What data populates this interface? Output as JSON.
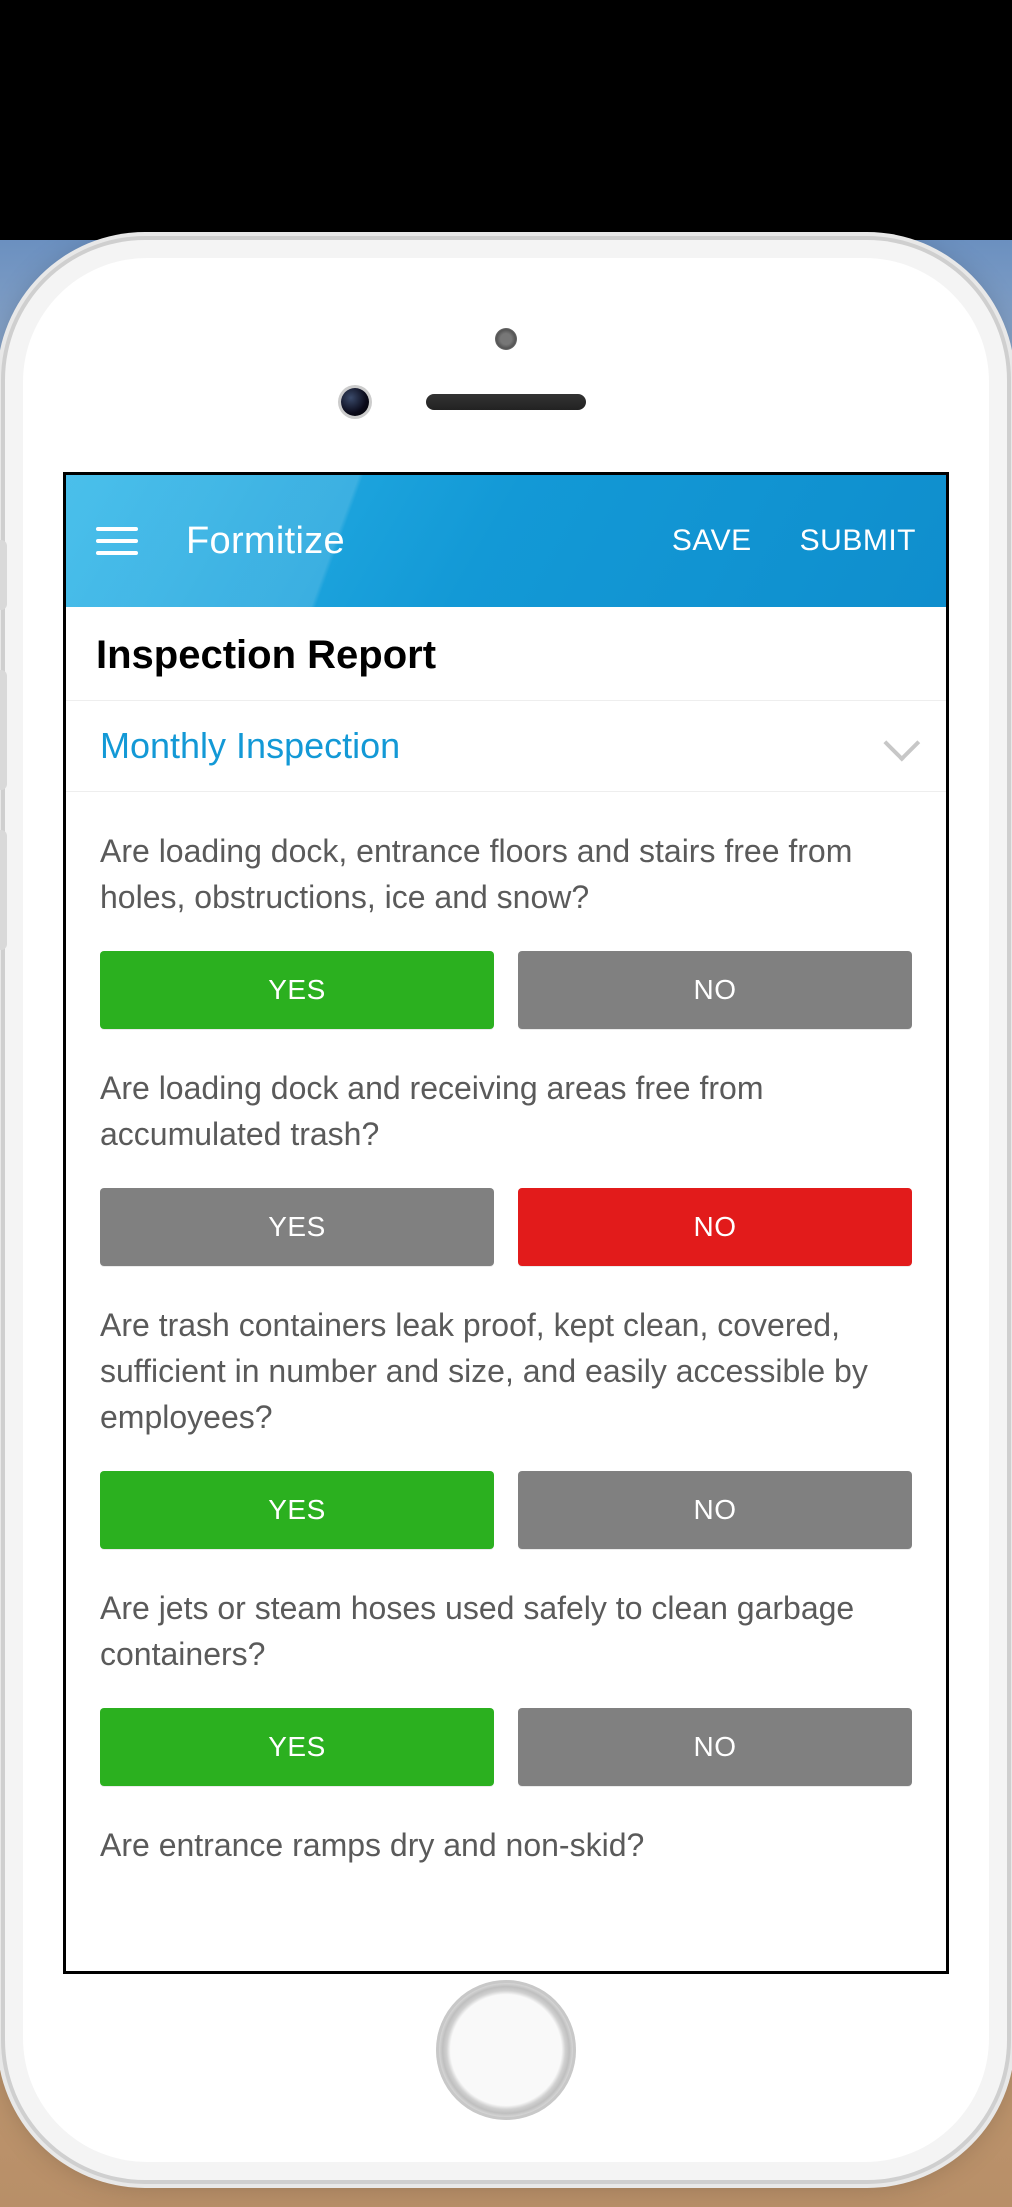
{
  "appbar": {
    "title": "Formitize",
    "save": "SAVE",
    "submit": "SUBMIT"
  },
  "page": {
    "title": "Inspection Report",
    "section": "Monthly Inspection"
  },
  "buttons": {
    "yes": "YES",
    "no": "NO"
  },
  "questions": [
    {
      "text": "Are loading dock, entrance floors and stairs free from holes, obstructions, ice and snow?",
      "answer": "yes"
    },
    {
      "text": "Are loading dock and receiving areas free from accumulated trash?",
      "answer": "no"
    },
    {
      "text": "Are trash containers leak proof, kept clean, covered, sufficient in number and size, and easily accessible by employees?",
      "answer": "yes"
    },
    {
      "text": "Are jets or steam hoses used safely to clean garbage containers?",
      "answer": "yes"
    },
    {
      "text": "Are entrance ramps dry and non-skid?",
      "answer": null
    }
  ],
  "colors": {
    "primary": "#1399d6",
    "yes": "#2bb01f",
    "no": "#e21b1b",
    "neutral": "#808080"
  }
}
